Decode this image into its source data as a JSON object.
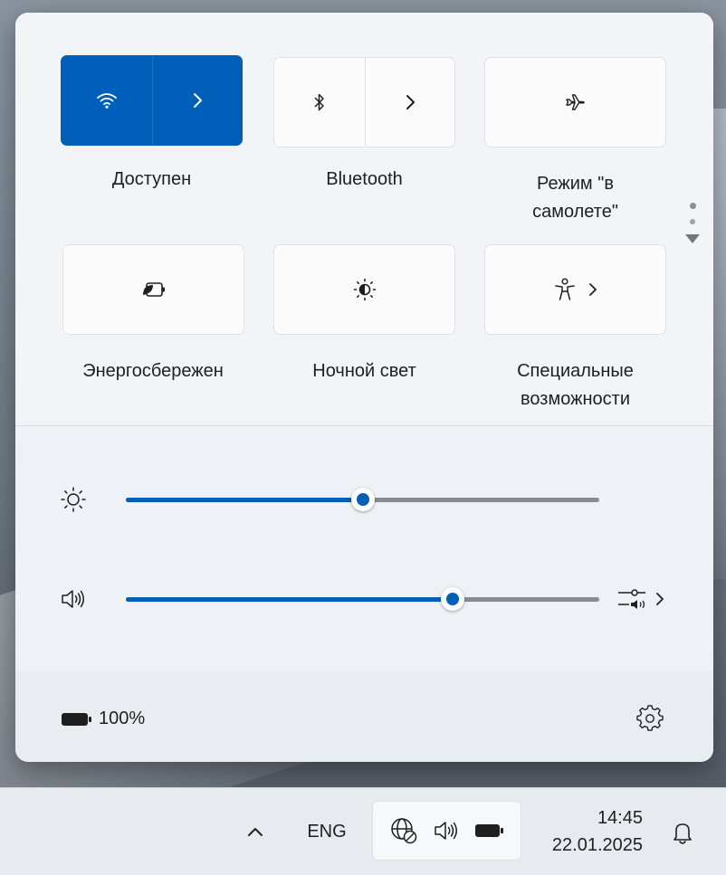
{
  "tiles": [
    {
      "id": "wifi",
      "label": "Доступен",
      "icon": "wifi-icon",
      "active": true,
      "split": true
    },
    {
      "id": "bluetooth",
      "label": "Bluetooth",
      "icon": "bluetooth-icon",
      "active": false,
      "split": true
    },
    {
      "id": "airplane",
      "label_line1": "Режим \"в",
      "label_line2": "самолете\"",
      "icon": "airplane-icon",
      "active": false,
      "split": false
    },
    {
      "id": "battery-saver",
      "label": "Энергосбережен",
      "icon": "battery-saver-icon",
      "active": false,
      "split": false
    },
    {
      "id": "night-light",
      "label": "Ночной свет",
      "icon": "night-light-icon",
      "active": false,
      "split": false
    },
    {
      "id": "accessibility",
      "label_line1": "Специальные",
      "label_line2": "возможности",
      "icon": "accessibility-icon",
      "active": false,
      "split": false
    }
  ],
  "brightness": {
    "icon": "brightness-icon",
    "value_percent": 50
  },
  "volume": {
    "icon": "speaker-icon",
    "value_percent": 69
  },
  "footer": {
    "battery_text": "100%",
    "battery_icon": "battery-icon",
    "settings_icon": "gear-icon"
  },
  "taskbar": {
    "language": "ENG",
    "time": "14:45",
    "date": "22.01.2025",
    "tray_icons": [
      "globe-no-internet-icon",
      "speaker-icon",
      "battery-icon"
    ],
    "overflow_icon": "chevron-up-icon",
    "notifications_icon": "bell-icon"
  },
  "colors": {
    "accent": "#005fb8",
    "flyout_bg": "#eef1f5",
    "taskbar_bg": "#e7ebf0"
  }
}
